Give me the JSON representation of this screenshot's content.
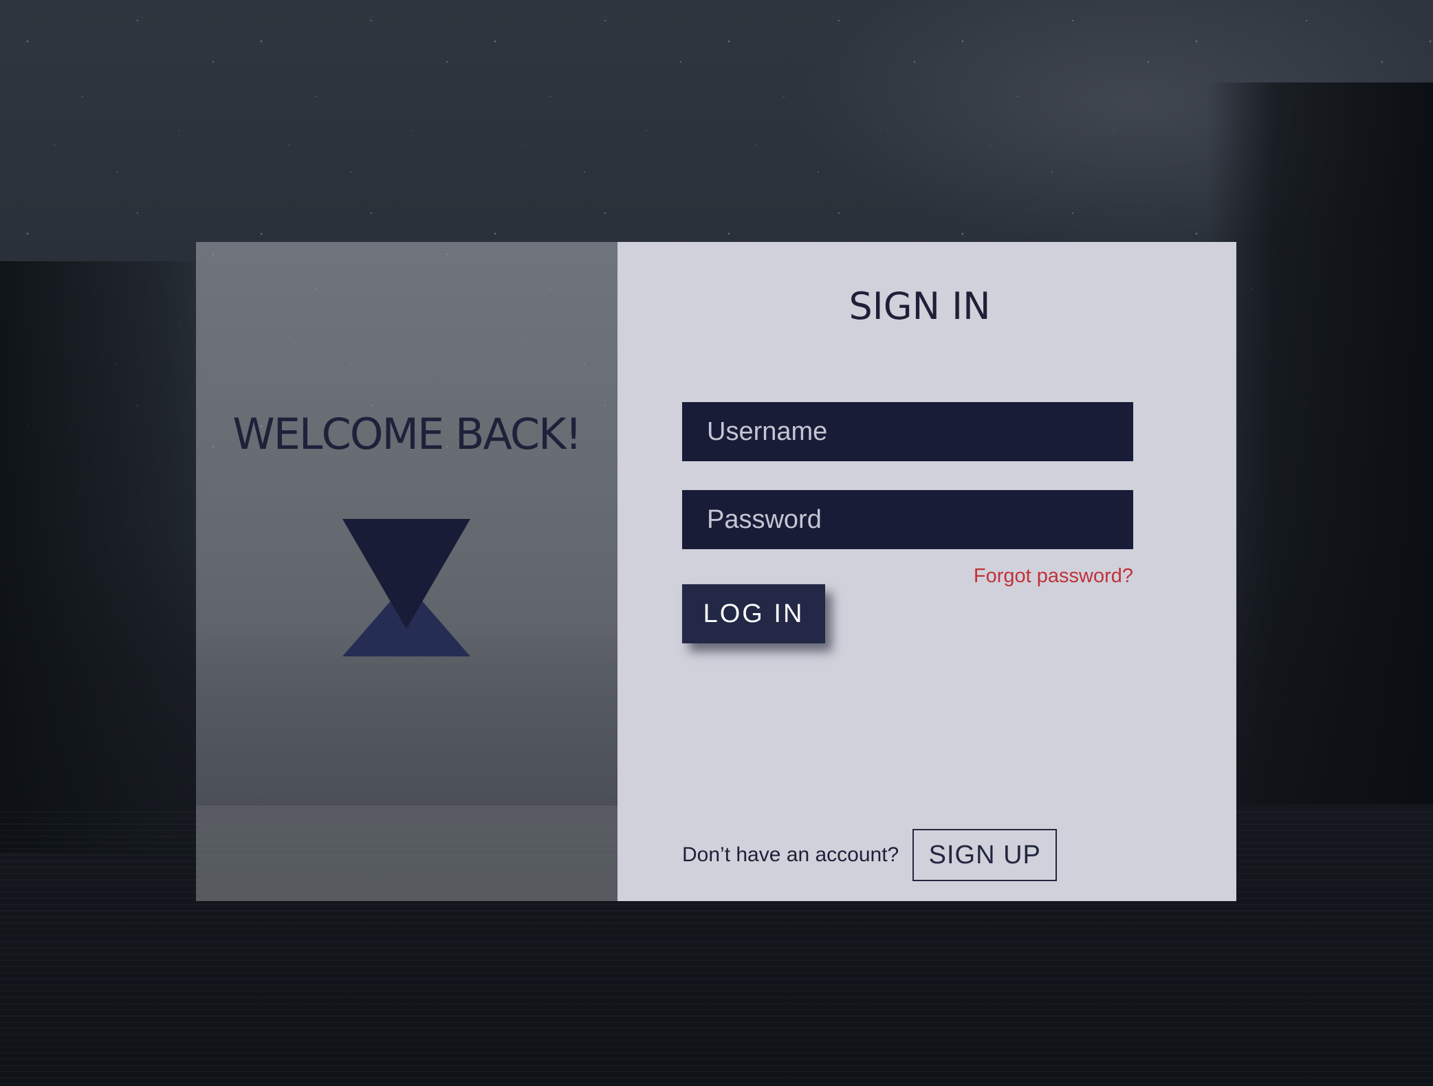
{
  "welcome": {
    "heading": "WELCOME BACK!",
    "logo_icon": "hourglass-triangles-logo-icon"
  },
  "signin": {
    "title": "SIGN IN",
    "username_placeholder": "Username",
    "password_placeholder": "Password",
    "forgot_label": "Forgot password?",
    "login_label": "LOG IN",
    "signup_prompt": "Don’t have an account?",
    "signup_label": "SIGN UP"
  },
  "colors": {
    "navy": "#181c37",
    "navy_light": "#252d54",
    "panel": "#d1d1db",
    "link_red": "#c0323a"
  }
}
